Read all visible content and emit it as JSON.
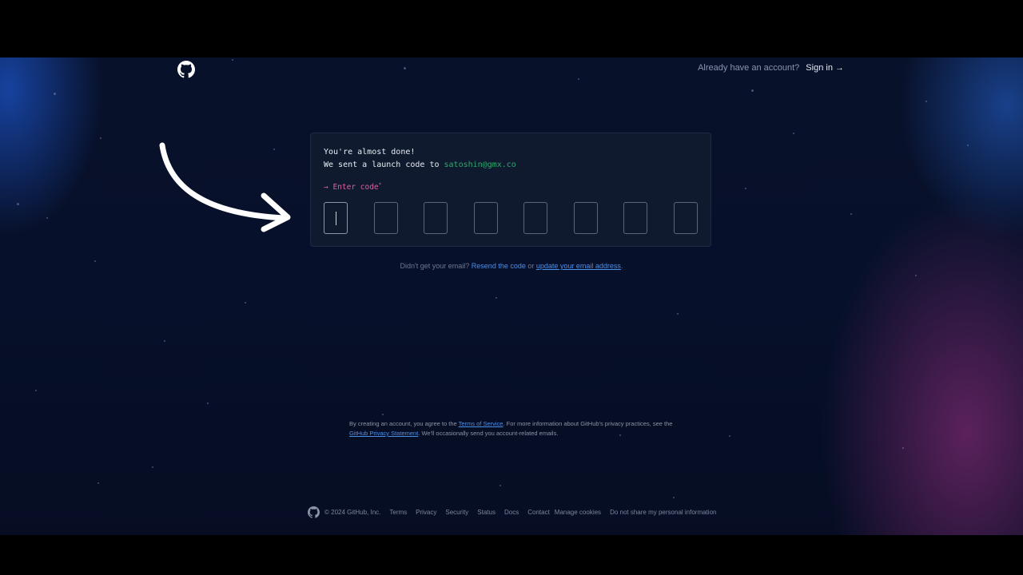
{
  "header": {
    "already_text": "Already have an account?",
    "signin_label": "Sign in →"
  },
  "card": {
    "line1": "You're almost done!",
    "line2_prefix": "We sent a launch code to ",
    "email": "satoshin@gmx.co",
    "code_label": "→ Enter code",
    "required_mark": "*",
    "code_length": 8
  },
  "resend": {
    "prefix": "Didn't get your email? ",
    "resend_link": "Resend the code",
    "or": " or ",
    "update_link": "update your email address",
    "suffix": "."
  },
  "legal": {
    "p1": "By creating an account, you agree to the ",
    "tos_link": "Terms of Service",
    "p2": ". For more information about GitHub's privacy practices, see the ",
    "privacy_link": "GitHub Privacy Statement",
    "p3": ". We'll occasionally send you account-related emails."
  },
  "footer": {
    "copyright": "© 2024 GitHub, Inc.",
    "links": [
      "Terms",
      "Privacy",
      "Security",
      "Status",
      "Docs",
      "Contact",
      "Manage cookies",
      "Do not share my personal information"
    ]
  },
  "colors": {
    "accent_link": "#4c8fe6",
    "email_green": "#2ea86a",
    "label_pink": "#db5fa7"
  },
  "icons": [
    "github-logo-icon",
    "arrow-annotation-icon"
  ]
}
